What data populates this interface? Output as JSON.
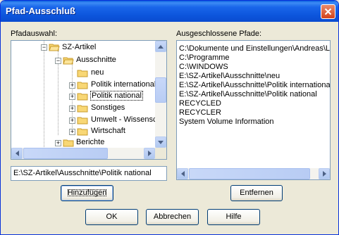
{
  "window": {
    "title": "Pfad-Ausschluß"
  },
  "left": {
    "label": "Pfadauswahl:",
    "tree": [
      {
        "label": "SZ-Artikel",
        "expander": "−"
      },
      {
        "label": "Ausschnitte",
        "expander": "−"
      },
      {
        "label": "neu",
        "expander": ""
      },
      {
        "label": "Politik international",
        "expander": "+"
      },
      {
        "label": "Politik national",
        "expander": "+"
      },
      {
        "label": "Sonstiges",
        "expander": "+"
      },
      {
        "label": "Umwelt - Wissensc",
        "expander": "+"
      },
      {
        "label": "Wirtschaft",
        "expander": "+"
      },
      {
        "label": "Berichte",
        "expander": "+"
      }
    ],
    "path_value": "E:\\SZ-Artikel\\Ausschnitte\\Politik national",
    "add_button": "Hinzufügen"
  },
  "right": {
    "label": "Ausgeschlossene Pfade:",
    "items": [
      "C:\\Dokumente und Einstellungen\\Andreas\\L",
      "C:\\Programme",
      "C:\\WINDOWS",
      "E:\\SZ-Artikel\\Ausschnitte\\neu",
      "E:\\SZ-Artikel\\Ausschnitte\\Politik international",
      "E:\\SZ-Artikel\\Ausschnitte\\Politik national",
      "RECYCLED",
      "RECYCLER",
      "System Volume Information"
    ],
    "remove_button": "Entfernen"
  },
  "buttons": {
    "ok": "OK",
    "cancel": "Abbrechen",
    "help": "Hilfe"
  }
}
